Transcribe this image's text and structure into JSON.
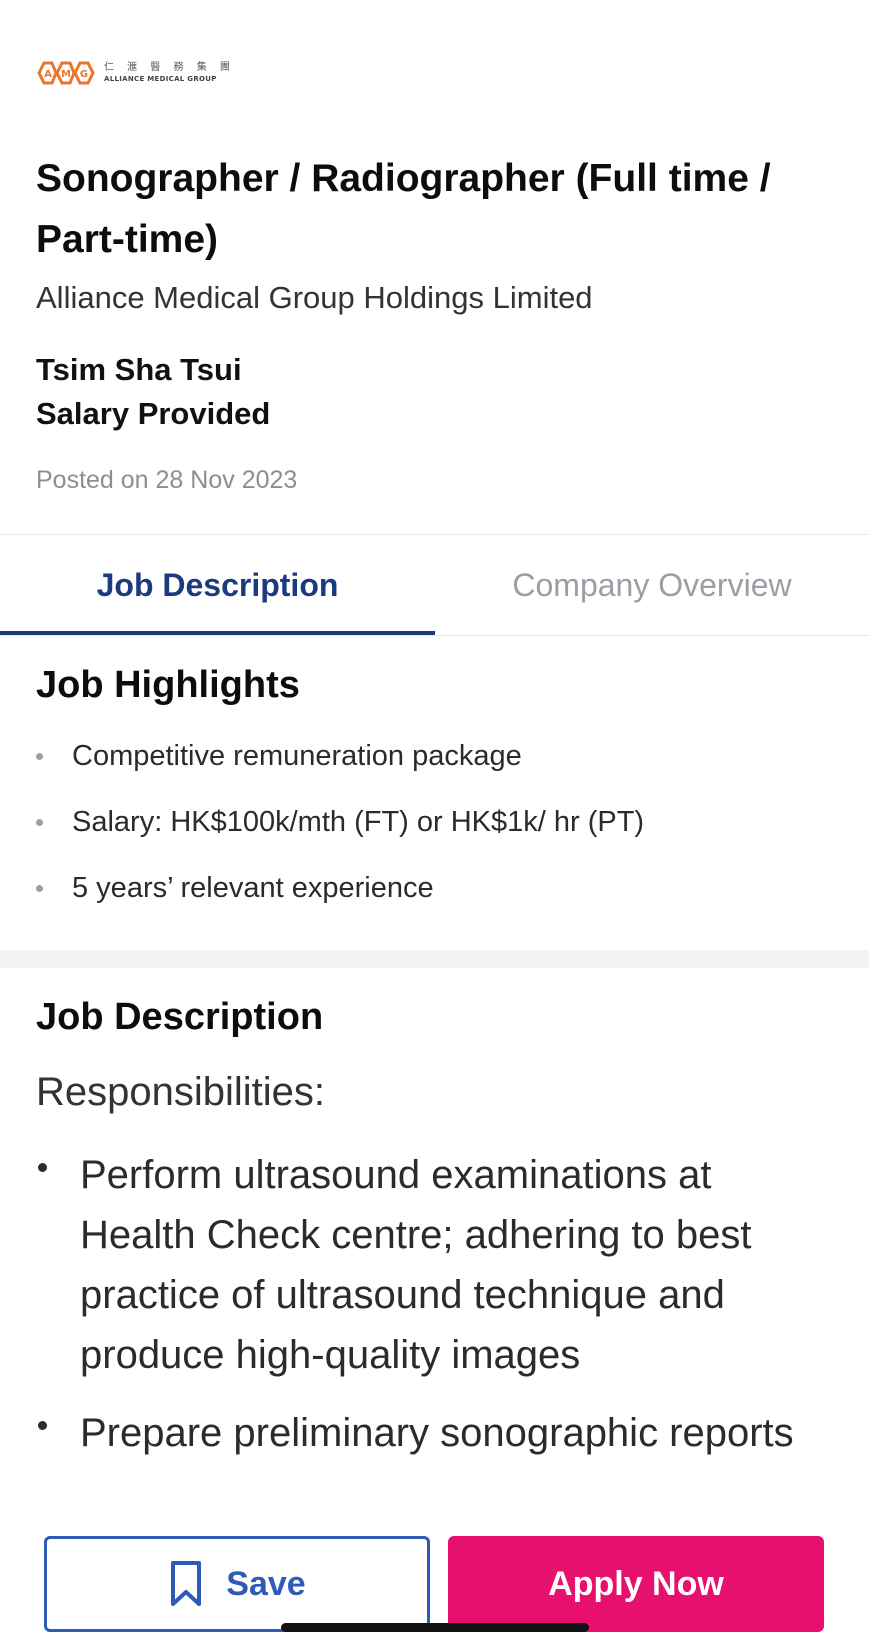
{
  "logo": {
    "chinese_text": "仁 滙 醫 務 集 團",
    "english_text": "ALLIANCE MEDICAL GROUP",
    "brand_color": "#e8772e"
  },
  "job": {
    "title": "Sonographer / Radiographer (Full time / Part-time)",
    "company": "Alliance Medical Group Holdings Limited",
    "location": "Tsim Sha Tsui",
    "salary": "Salary Provided",
    "posted": "Posted on 28 Nov 2023"
  },
  "tabs": [
    {
      "label": "Job Description",
      "active": true
    },
    {
      "label": "Company Overview",
      "active": false
    }
  ],
  "highlights": {
    "heading": "Job Highlights",
    "items": [
      "Competitive remuneration package",
      "Salary: HK$100k/mth (FT) or HK$1k/ hr (PT)",
      "5 years’ relevant experience"
    ]
  },
  "description": {
    "heading": "Job Description",
    "subheading": "Responsibilities:",
    "items": [
      "Perform ultrasound examinations at Health Check centre; adhering to best practice of ultrasound technique and produce high-quality images",
      "Prepare preliminary sonographic reports"
    ]
  },
  "actions": {
    "save_label": "Save",
    "save_icon": "bookmark-icon",
    "apply_label": "Apply Now"
  },
  "colors": {
    "accent_blue": "#1b3a80",
    "save_blue": "#2d5bb7",
    "apply_pink": "#e8106f"
  }
}
